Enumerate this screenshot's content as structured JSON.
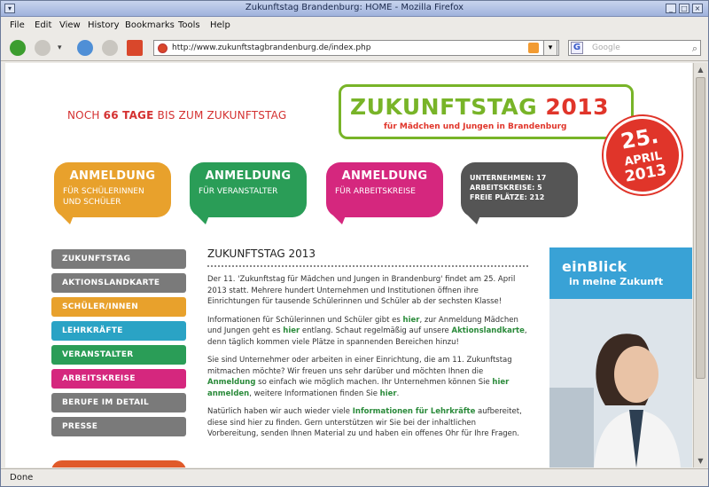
{
  "window": {
    "title": "Zukunftstag Brandenburg: HOME - Mozilla Firefox"
  },
  "menu": [
    "File",
    "Edit",
    "View",
    "History",
    "Bookmarks",
    "Tools",
    "Help"
  ],
  "url": "http://www.zukunftstagbrandenburg.de/index.php",
  "search": {
    "placeholder": "Google",
    "engine_glyph": "G"
  },
  "status": "Done",
  "page": {
    "countdown": {
      "prefix": "NOCH",
      "days": "66 TAGE",
      "suffix": "BIS ZUM ZUKUNFTSTAG"
    },
    "logo": {
      "word": "ZUKUNFTSTAG",
      "year": "2013",
      "subtitle": "für Mädchen und Jungen in Brandenburg"
    },
    "date_badge": {
      "day": "25.",
      "month": "APRIL",
      "year": "2013"
    },
    "bubbles": [
      {
        "title": "ANMELDUNG",
        "sub": "FÜR SCHÜLERINNEN UND SCHÜLER"
      },
      {
        "title": "ANMELDUNG",
        "sub": "FÜR VERANSTALTER"
      },
      {
        "title": "ANMELDUNG",
        "sub": "FÜR ARBEITSKREISE"
      }
    ],
    "stats": [
      "UNTERNEHMEN: 17",
      "ARBEITSKREISE: 5",
      "FREIE PLÄTZE: 212"
    ],
    "nav": [
      "ZUKUNFTSTAG",
      "AKTIONSLANDKARTE",
      "SCHÜLER/INNEN",
      "LEHRKRÄFTE",
      "VERANSTALTER",
      "ARBEITSKREISE",
      "BERUFE IM DETAIL",
      "PRESSE"
    ],
    "heading": "ZUKUNFTSTAG 2013",
    "p1": "Der 11. 'Zukunftstag für Mädchen und Jungen in Brandenburg' findet am 25. April 2013 statt. Mehrere hundert Unternehmen und Institutionen öffnen ihre Einrichtungen für tausende Schülerinnen und Schüler ab der sechsten Klasse!",
    "p2": {
      "a": "Informationen für Schülerinnen und Schüler gibt es ",
      "l1": "hier",
      "b": ", zur Anmeldung Mädchen und Jungen geht es ",
      "l2": "hier",
      "c": " entlang. Schaut regelmäßig auf unsere ",
      "l3": "Aktionslandkarte",
      "d": ", denn täglich kommen viele Plätze in spannenden Bereichen hinzu!"
    },
    "p3": {
      "a": "Sie sind Unternehmer oder arbeiten in einer Einrichtung, die am 11. Zukunftstag mitmachen möchte? Wir freuen uns sehr darüber und möchten Ihnen die ",
      "l1": "Anmeldung",
      "b": " so einfach wie möglich machen. Ihr Unternehmen können Sie ",
      "l2": "hier anmelden",
      "c": ", weitere Informationen finden Sie ",
      "l3": "hier",
      "d": "."
    },
    "p4": {
      "a": "Natürlich haben wir auch wieder viele ",
      "l1": "Informationen für Lehrkräfte",
      "b": " aufbereitet, diese sind hier zu finden. Gern unterstützen wir Sie bei der inhaltlichen Vorbereitung, senden Ihnen Material zu und haben ein offenes Ohr für Ihre Fragen."
    },
    "banner": {
      "line1": "einBlick",
      "line2": "in meine Zukunft"
    }
  }
}
